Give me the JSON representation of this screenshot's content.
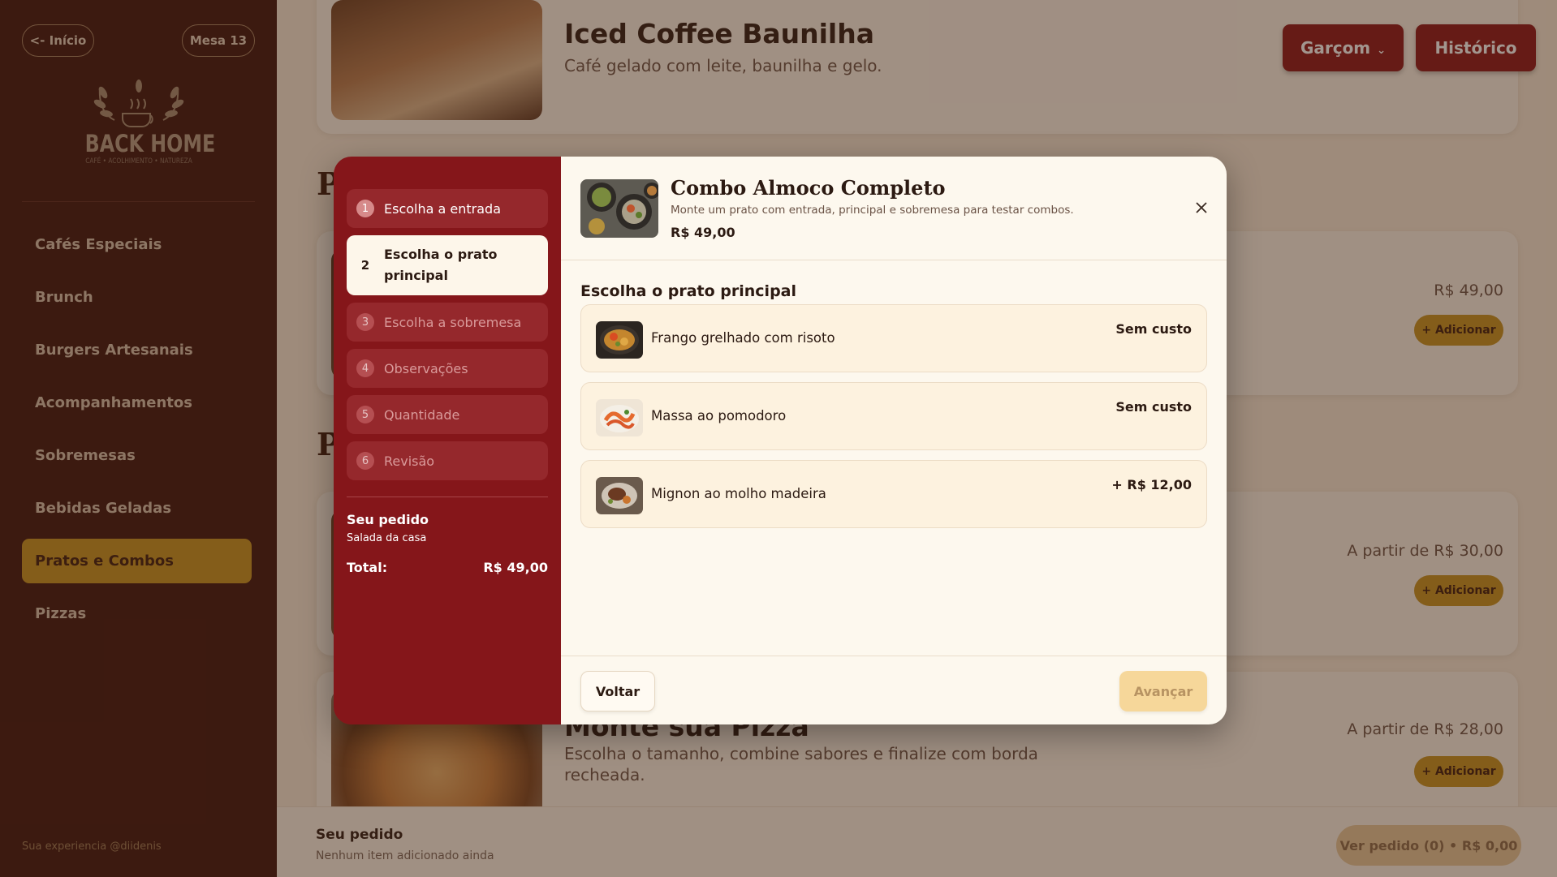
{
  "sidebar": {
    "back_label": "<- Início",
    "table_label": "Mesa 13",
    "brand_name": "BACK HOME",
    "brand_tagline": "CAFÉ • ACOLHIMENTO • NATUREZA",
    "nav": [
      {
        "label": "Cafés Especiais"
      },
      {
        "label": "Brunch"
      },
      {
        "label": "Burgers Artesanais"
      },
      {
        "label": "Acompanhamentos"
      },
      {
        "label": "Sobremesas"
      },
      {
        "label": "Bebidas Geladas"
      },
      {
        "label": "Pratos e Combos",
        "active": true
      },
      {
        "label": "Pizzas"
      }
    ],
    "footer": "Sua experiencia @diidenis"
  },
  "header_buttons": {
    "waiter": "Garçom",
    "history": "Histórico"
  },
  "menu": {
    "item_top": {
      "title": "Iced Coffee Baunilha",
      "description": "Café gelado com leite, baunilha e gelo."
    },
    "section_letters": [
      "P",
      "P"
    ],
    "item_combo": {
      "price": "R$ 49,00",
      "add_label": "+ Adicionar"
    },
    "item_mid": {
      "price": "A partir de R$ 30,00",
      "add_label": "+ Adicionar"
    },
    "item_pizza": {
      "title": "Monte sua Pizza",
      "description": "Escolha o tamanho, combine sabores e finalize com borda recheada.",
      "price": "A partir de R$ 28,00",
      "add_label": "+ Adicionar"
    }
  },
  "bottom_bar": {
    "title": "Seu pedido",
    "subtitle": "Nenhum item adicionado ainda",
    "button": "Ver pedido (0) • R$ 0,00"
  },
  "modal": {
    "steps": [
      {
        "num": "1",
        "label": "Escolha a entrada",
        "state": "done"
      },
      {
        "num": "2",
        "label": "Escolha o prato principal",
        "state": "current"
      },
      {
        "num": "3",
        "label": "Escolha a sobremesa",
        "state": "pending"
      },
      {
        "num": "4",
        "label": "Observações",
        "state": "pending"
      },
      {
        "num": "5",
        "label": "Quantidade",
        "state": "pending"
      },
      {
        "num": "6",
        "label": "Revisão",
        "state": "pending"
      }
    ],
    "summary": {
      "title": "Seu pedido",
      "item": "Salada da casa",
      "total_label": "Total:",
      "total_value": "R$ 49,00"
    },
    "title": "Combo Almoco Completo",
    "description": "Monte um prato com entrada, principal e sobremesa para testar combos.",
    "price": "R$ 49,00",
    "section_title": "Escolha o prato principal",
    "options": [
      {
        "name": "Frango grelhado com risoto",
        "cost": "Sem custo"
      },
      {
        "name": "Massa ao pomodoro",
        "cost": "Sem custo"
      },
      {
        "name": "Mignon ao molho madeira",
        "cost": "+ R$ 12,00"
      }
    ],
    "back_label": "Voltar",
    "next_label": "Avançar"
  }
}
